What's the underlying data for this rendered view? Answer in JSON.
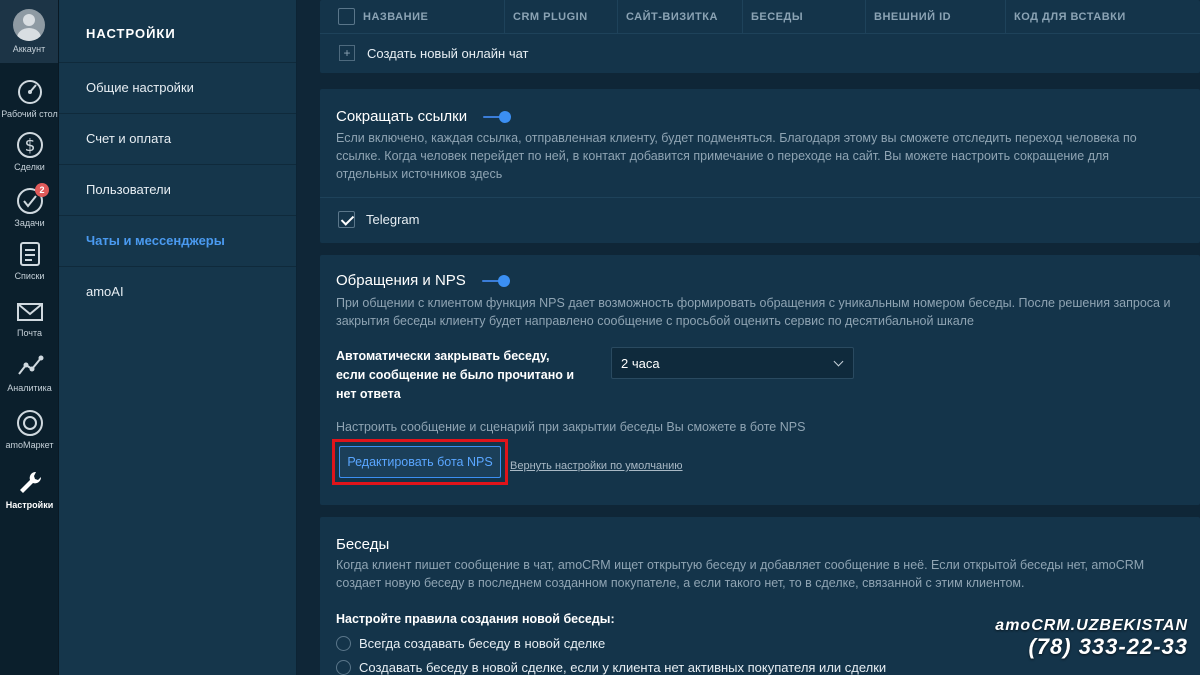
{
  "rail": {
    "account": "Аккаунт",
    "items": [
      {
        "label": "Рабочий стол",
        "icon": "dashboard-icon"
      },
      {
        "label": "Сделки",
        "icon": "dollar-icon"
      },
      {
        "label": "Задачи",
        "icon": "checkmark-circle-icon",
        "badge": "2"
      },
      {
        "label": "Списки",
        "icon": "list-icon"
      },
      {
        "label": "Почта",
        "icon": "mail-icon"
      },
      {
        "label": "Аналитика",
        "icon": "analytics-icon"
      },
      {
        "label": "amoМаркет",
        "icon": "market-icon"
      },
      {
        "label": "Настройки",
        "icon": "wrench-icon",
        "active": true
      }
    ]
  },
  "menu": {
    "title": "НАСТРОЙКИ",
    "items": [
      "Общие настройки",
      "Счет и оплата",
      "Пользователи",
      "Чаты и мессенджеры",
      "amoAI"
    ],
    "active_index": 3
  },
  "chats_table": {
    "headers": [
      "НАЗВАНИЕ",
      "CRM PLUGIN",
      "САЙТ-ВИЗИТКА",
      "БЕСЕДЫ",
      "ВНЕШНИЙ ID",
      "КОД ДЛЯ ВСТАВКИ"
    ],
    "create_label": "Создать новый онлайн чат"
  },
  "shorten": {
    "title": "Сокращать ссылки",
    "enabled": true,
    "desc": "Если включено, каждая ссылка, отправленная клиенту, будет подменяться. Благодаря этому вы сможете отследить переход человека по ссылке. Когда человек перейдет по ней, в контакт добавится примечание о переходе на сайт. Вы можете настроить сокращение для отдельных источников здесь",
    "source_label": "Telegram",
    "source_checked": true
  },
  "nps": {
    "title": "Обращения и NPS",
    "enabled": true,
    "desc": "При общении с клиентом функция NPS дает возможность формировать обращения с уникальным номером беседы. После решения запроса и закрытия беседы клиенту будет направлено сообщение с просьбой оценить сервис по десятибальной шкале",
    "auto_close_label": "Автоматически закрывать беседу, если сообщение не было прочитано и нет ответа",
    "auto_close_value": "2 часа",
    "config_hint": "Настроить сообщение и сценарий при закрытии беседы Вы сможете в боте NPS",
    "edit_button": "Редактировать бота NPS",
    "reset_link": "Вернуть настройки по умолчанию"
  },
  "talks": {
    "title": "Беседы",
    "desc": "Когда клиент пишет сообщение в чат, amoCRM ищет открытую беседу и добавляет сообщение в неё. Если открытой беседы нет, amoCRM создает новую беседу в последнем созданном покупателе, а если такого нет, то в сделке, связанной с этим клиентом.",
    "rules_title": "Настройте правила создания новой беседы:",
    "options": [
      "Всегда создавать беседу в новой сделке",
      "Создавать беседу в новой сделке, если у клиента нет активных покупателя или сделки"
    ]
  },
  "watermark": {
    "brand": "amoCRM.UZBEKISTAN",
    "phone": "(78) 333-22-33"
  },
  "colors": {
    "background": "#0f2637",
    "panel": "#14344a",
    "accent": "#3b8ff3",
    "highlight": "#e0141b"
  }
}
